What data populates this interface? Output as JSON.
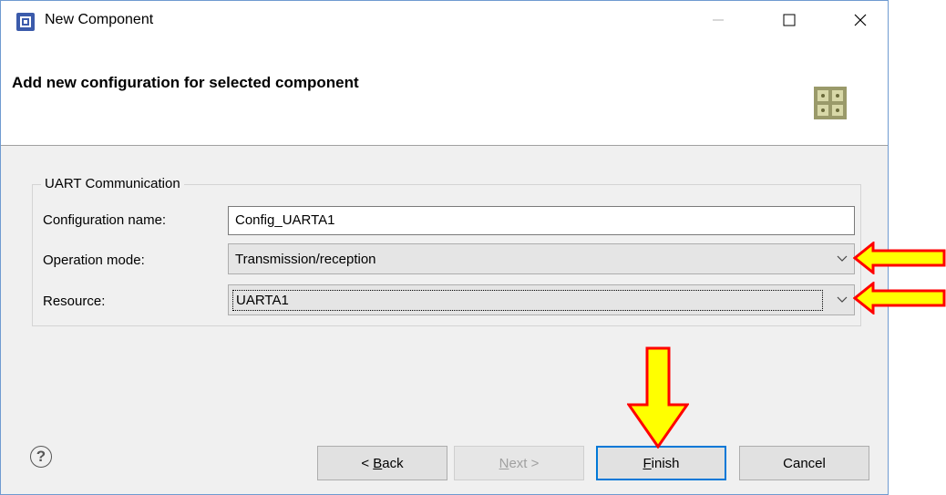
{
  "window": {
    "title": "New Component"
  },
  "header": {
    "title": "Add new configuration for selected component"
  },
  "group": {
    "title": "UART Communication",
    "config_name_label": "Configuration name:",
    "config_name_value": "Config_UARTA1",
    "operation_mode_label": "Operation mode:",
    "operation_mode_value": "Transmission/reception",
    "resource_label": "Resource:",
    "resource_value": "UARTA1"
  },
  "buttons": {
    "back_mnemonic": "B",
    "back_rest": "ack",
    "back_prefix": "< ",
    "next_mnemonic": "N",
    "next_rest": "ext >",
    "finish_mnemonic": "F",
    "finish_rest": "inish",
    "cancel": "Cancel"
  },
  "icons": {
    "help": "?",
    "app": "chip-icon",
    "component": "component-grid-icon"
  },
  "colors": {
    "arrow_fill": "#ffff00",
    "arrow_stroke": "#ff0000",
    "focus_border": "#0078d7"
  }
}
